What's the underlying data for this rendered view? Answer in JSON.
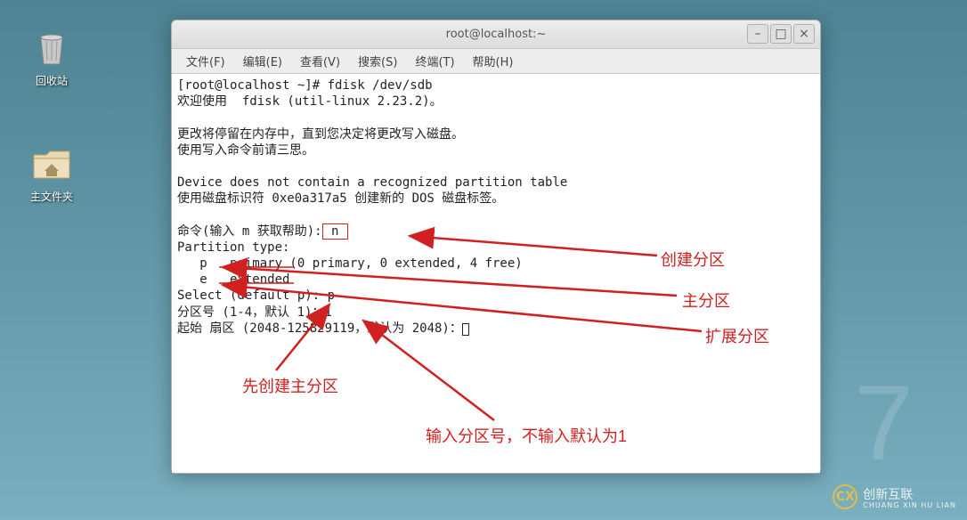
{
  "desktop": {
    "trash_label": "回收站",
    "home_label": "主文件夹"
  },
  "window": {
    "title": "root@localhost:~"
  },
  "menu": {
    "file": "文件(F)",
    "edit": "编辑(E)",
    "view": "查看(V)",
    "search": "搜索(S)",
    "terminal": "终端(T)",
    "help": "帮助(H)"
  },
  "terminal": {
    "line1": "[root@localhost ~]# fdisk /dev/sdb",
    "line2": "欢迎使用  fdisk (util-linux 2.23.2)。",
    "line3": "",
    "line4": "更改将停留在内存中，直到您决定将更改写入磁盘。",
    "line5": "使用写入命令前请三思。",
    "line6": "",
    "line7": "Device does not contain a recognized partition table",
    "line8": "使用磁盘标识符 0xe0a317a5 创建新的 DOS 磁盘标签。",
    "line9": "",
    "line10a": "命令(输入 m 获取帮助):",
    "line10b": " n ",
    "line11": "Partition type:",
    "line12": "   p   primary (0 primary, 0 extended, 4 free)",
    "line13": "   e   extended",
    "line14": "Select (default p): p",
    "line15": "分区号 (1-4，默认 1)：1",
    "line16": "起始 扇区 (2048-125829119，默认为 2048)："
  },
  "annotations": {
    "a1": "创建分区",
    "a2": "主分区",
    "a3": "扩展分区",
    "a4": "先创建主分区",
    "a5": "输入分区号，不输入默认为1"
  },
  "watermark": {
    "centos": "7",
    "brand": "创新互联",
    "brand_sub": "CHUANG XIN HU LIAN"
  }
}
